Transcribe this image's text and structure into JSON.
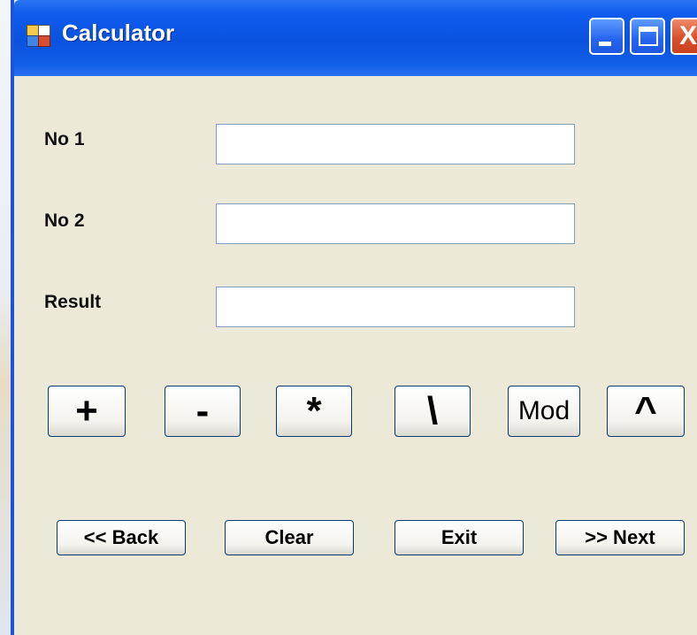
{
  "window": {
    "title": "Calculator"
  },
  "title_buttons": {
    "minimize_icon": "minimize-icon",
    "maximize_icon": "maximize-icon",
    "close_icon": "close-icon",
    "close_glyph": "X"
  },
  "form": {
    "no1_label": "No 1",
    "no1_value": "",
    "no2_label": "No 2",
    "no2_value": "",
    "result_label": "Result",
    "result_value": ""
  },
  "operators": {
    "add": "+",
    "subtract": "-",
    "multiply": "*",
    "divide": "\\",
    "mod": "Mod",
    "power": "^"
  },
  "navigation": {
    "back": "<< Back",
    "clear": "Clear",
    "exit": "Exit",
    "next": ">> Next"
  },
  "colors": {
    "titlebar": "#0a52df",
    "window_bg": "#ece9d8",
    "button_border": "#003c74",
    "close_button": "#d9502c"
  }
}
